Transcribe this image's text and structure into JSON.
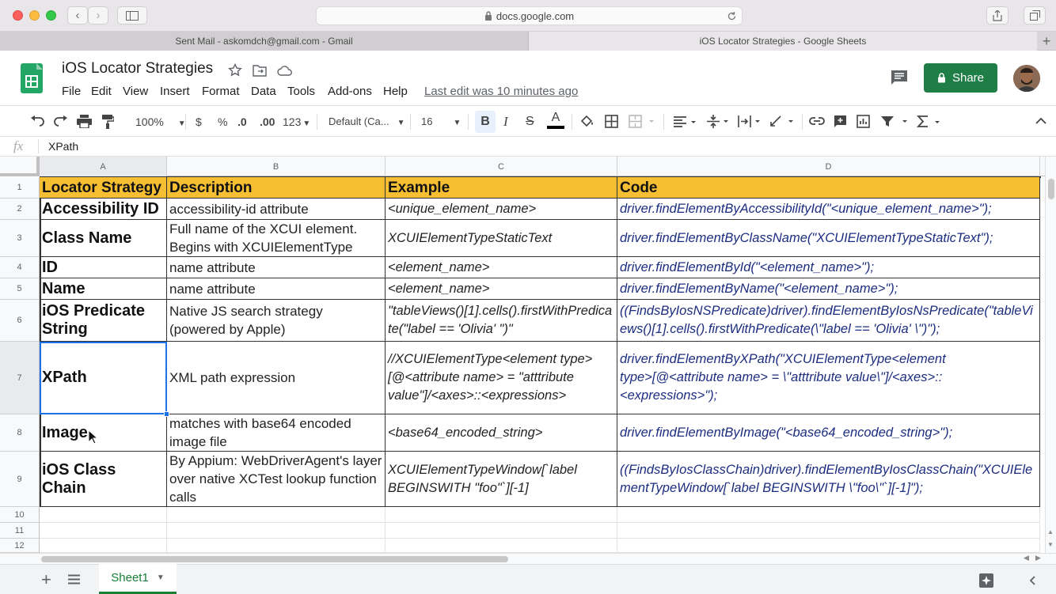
{
  "browser": {
    "url": "docs.google.com",
    "tabs": [
      {
        "label": "Sent Mail - askomdch@gmail.com - Gmail",
        "active": false
      },
      {
        "label": "iOS Locator Strategies - Google Sheets",
        "active": true
      }
    ]
  },
  "doc": {
    "title": "iOS Locator Strategies",
    "menu": [
      "File",
      "Edit",
      "View",
      "Insert",
      "Format",
      "Data",
      "Tools",
      "Add-ons",
      "Help"
    ],
    "last_edit": "Last edit was 10 minutes ago",
    "share_label": "Share"
  },
  "toolbar": {
    "zoom": "100%",
    "currency": "$",
    "percent": "%",
    "dec_decrease": ".0",
    "dec_increase": ".00",
    "more_formats": "123",
    "font": "Default (Ca...",
    "font_size": "16",
    "bold": "B",
    "italic": "I",
    "strike": "S",
    "text_color": "A"
  },
  "formula_bar": {
    "fx": "fx",
    "value": "XPath"
  },
  "grid": {
    "columns": [
      "A",
      "B",
      "C",
      "D"
    ],
    "rows": [
      "1",
      "2",
      "3",
      "4",
      "5",
      "6",
      "7",
      "8",
      "9",
      "10",
      "11",
      "12"
    ],
    "header": [
      "Locator Strategy",
      "Description",
      "Example",
      "Code"
    ],
    "data": [
      [
        "Accessibility ID",
        "accessibility-id attribute",
        "<unique_element_name>",
        "driver.findElementByAccessibilityId(\"<unique_element_name>\");"
      ],
      [
        "Class Name",
        "Full name of the XCUI element. Begins with XCUIElementType",
        "XCUIElementTypeStaticText",
        "driver.findElementByClassName(\"XCUIElementTypeStaticText\");"
      ],
      [
        "ID",
        "name attribute",
        "<element_name>",
        "driver.findElementById(\"<element_name>\");"
      ],
      [
        "Name",
        "name attribute",
        "<element_name>",
        "driver.findElementByName(\"<element_name>\");"
      ],
      [
        "iOS Predicate String",
        "Native JS search strategy (powered by Apple)",
        "\"tableViews()[1].cells().firstWithPredicate(\"label == 'Olivia' \")\"",
        "((FindsByIosNSPredicate)driver).findElementByIosNsPredicate(\"tableViews()[1].cells().firstWithPredicate(\\\"label == 'Olivia' \\\")\");"
      ],
      [
        "XPath",
        "XML path expression",
        "//XCUIElementType<element type>[@<attribute name> = \"atttribute value\"]/<axes>::<expressions>",
        "driver.findElementByXPath(\"XCUIElementType<element type>[@<attribute name> = \\\"atttribute value\\\"]/<axes>::<expressions>\");"
      ],
      [
        "Image",
        "matches with base64 encoded image file",
        "<base64_encoded_string>",
        "driver.findElementByImage(\"<base64_encoded_string>\");"
      ],
      [
        "iOS Class Chain",
        "By Appium: WebDriverAgent's layer over native XCTest lookup function calls",
        "XCUIElementTypeWindow[`label BEGINSWITH \"foo\"`][-1]",
        "((FindsByIosClassChain)driver).findElementByIosClassChain(\"XCUIElementTypeWindow[`label BEGINSWITH \\\"foo\\\"`][-1]\");"
      ]
    ]
  },
  "sheet_tabs": [
    {
      "label": "Sheet1",
      "active": true
    }
  ],
  "colors": {
    "header_fill": "#f6be33",
    "code_text": "#1c2d80",
    "share_button": "#1e7e45",
    "selection": "#1a73e8"
  }
}
